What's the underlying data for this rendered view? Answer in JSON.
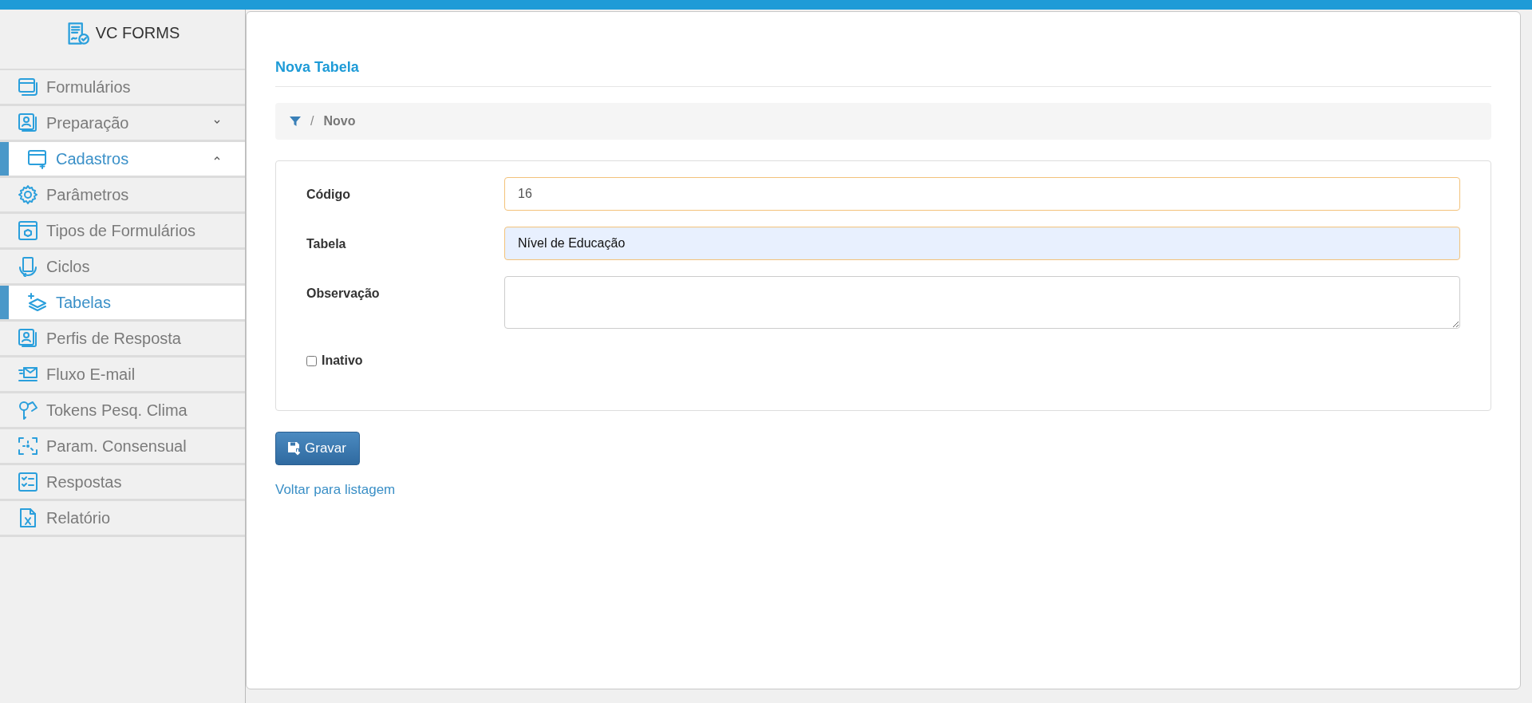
{
  "app": {
    "title": "VC FORMS"
  },
  "sidebar": {
    "items": [
      {
        "label": "Formulários",
        "selected": false
      },
      {
        "label": "Preparação",
        "selected": false,
        "expanded": false
      },
      {
        "label": "Cadastros",
        "selected": true,
        "expanded": true,
        "children": [
          {
            "label": "Parâmetros",
            "selected": false
          },
          {
            "label": "Tipos de Formulários",
            "selected": false
          },
          {
            "label": "Ciclos",
            "selected": false
          },
          {
            "label": "Tabelas",
            "selected": true
          },
          {
            "label": "Perfis de Resposta",
            "selected": false
          },
          {
            "label": "Fluxo E-mail",
            "selected": false
          },
          {
            "label": "Tokens Pesq. Clima",
            "selected": false
          },
          {
            "label": "Param. Consensual",
            "selected": false
          }
        ]
      },
      {
        "label": "Respostas",
        "selected": false
      },
      {
        "label": "Relatório",
        "selected": false
      }
    ]
  },
  "page": {
    "title": "Nova Tabela",
    "breadcrumb_separator": "/",
    "breadcrumb": [
      "Novo"
    ]
  },
  "form": {
    "fields": [
      {
        "label": "Código",
        "kind": "text",
        "value": "16",
        "disabled": true
      },
      {
        "label": "Tabela",
        "kind": "text",
        "value": "Nível de Educação",
        "disabled": false
      },
      {
        "label": "Observação",
        "kind": "textarea"
      },
      {
        "label": "Inativo",
        "kind": "checkbox",
        "checked": false
      }
    ],
    "save_button": "Gravar",
    "back_link": "Voltar para listagem"
  }
}
